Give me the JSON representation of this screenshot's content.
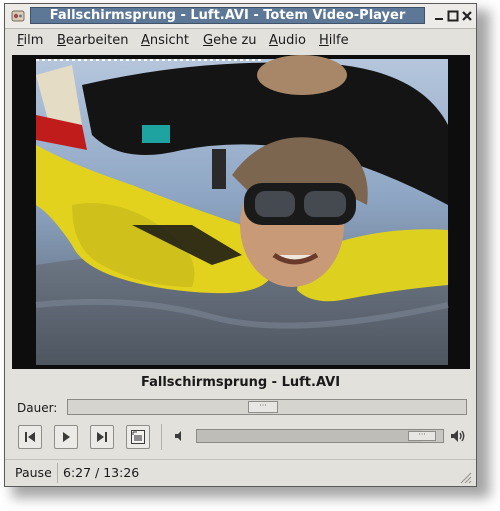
{
  "window": {
    "title": "Fallschirmsprung - Luft.AVI - Totem Video-Player"
  },
  "menubar": {
    "items": [
      {
        "label": "Film",
        "accel": "F"
      },
      {
        "label": "Bearbeiten",
        "accel": "B"
      },
      {
        "label": "Ansicht",
        "accel": "A"
      },
      {
        "label": "Gehe zu",
        "accel": "G"
      },
      {
        "label": "Audio",
        "accel": "A"
      },
      {
        "label": "Hilfe",
        "accel": "H"
      }
    ]
  },
  "player": {
    "filename": "Fallschirmsprung - Luft.AVI",
    "duration_label": "Dauer:",
    "seek_fraction": 0.49,
    "volume_fraction": 0.97
  },
  "controls": {
    "previous": "previous-icon",
    "play": "play-icon",
    "next": "next-icon",
    "fullscreen": "fullscreen-icon",
    "volume_low": "volume-low-icon",
    "volume_high": "volume-high-icon"
  },
  "status": {
    "state": "Pause",
    "time": "6:27 / 13:26"
  },
  "colors": {
    "title_bg": "#5c7896",
    "window_bg": "#e3e1dc",
    "sky": "#9fb3cc",
    "suit_yellow": "#e2d21e"
  }
}
